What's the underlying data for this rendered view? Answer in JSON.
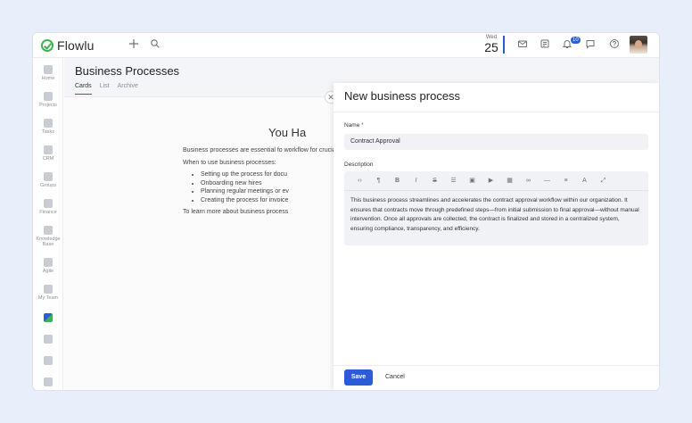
{
  "app": {
    "name": "Flowlu"
  },
  "topbar": {
    "date": {
      "weekday": "Wed",
      "day": "25"
    },
    "notifications_count": "10",
    "icons": [
      "plus-icon",
      "search-icon",
      "mail-icon",
      "notes-icon",
      "bell-icon",
      "chat-icon",
      "help-icon"
    ]
  },
  "sidebar": {
    "items": [
      {
        "label": "Home",
        "icon": "home-icon"
      },
      {
        "label": "Projects",
        "icon": "projects-icon"
      },
      {
        "label": "Tasks",
        "icon": "tasks-icon"
      },
      {
        "label": "CRM",
        "icon": "crm-icon"
      },
      {
        "label": "Groups",
        "icon": "groups-icon"
      },
      {
        "label": "Finance",
        "icon": "finance-icon"
      },
      {
        "label": "Knowledge Base",
        "icon": "knowledge-icon"
      },
      {
        "label": "Agile",
        "icon": "agile-icon"
      },
      {
        "label": "My Team",
        "icon": "team-icon"
      },
      {
        "label": "",
        "icon": "processes-icon"
      },
      {
        "label": "",
        "icon": "apps-icon"
      },
      {
        "label": "",
        "icon": "settings-icon"
      },
      {
        "label": "",
        "icon": "more-icon"
      }
    ]
  },
  "page": {
    "title": "Business Processes",
    "tabs": [
      {
        "label": "Cards",
        "active": true
      },
      {
        "label": "List",
        "active": false
      },
      {
        "label": "Archive",
        "active": false
      }
    ],
    "empty_state": {
      "heading": "You Ha",
      "intro": "Business processes are essential fo workflow for crucial activities.",
      "when_label": "When to use business processes:",
      "bullets": [
        "Setting up the process for docu",
        "Onboarding new hires",
        "Planning regular meetings or ev",
        "Creating the process for invoice"
      ],
      "learn_more": "To learn more about business process"
    }
  },
  "panel": {
    "title": "New business process",
    "name_label": "Name",
    "name_value": "Contract Approval",
    "description_label": "Description",
    "description_text": "This business process streamlines and accelerates the contract approval workflow within our organization. It ensures that contracts move through predefined steps—from initial submission to final approval—without manual intervention. Once all approvals are collected, the contract is finalized and stored in a centralized system, ensuring compliance, transparency, and efficiency.",
    "toolbar_tools": [
      "code-icon",
      "paragraph-icon",
      "bold-icon",
      "italic-icon",
      "strike-icon",
      "list-icon",
      "image-icon",
      "video-icon",
      "table-icon",
      "link-icon",
      "hr-icon",
      "align-icon",
      "text-color-icon",
      "expand-icon"
    ],
    "save_label": "Save",
    "cancel_label": "Cancel"
  },
  "colors": {
    "accent": "#2b5bd7",
    "brand": "#3fb24f",
    "required": "#e0443c"
  }
}
